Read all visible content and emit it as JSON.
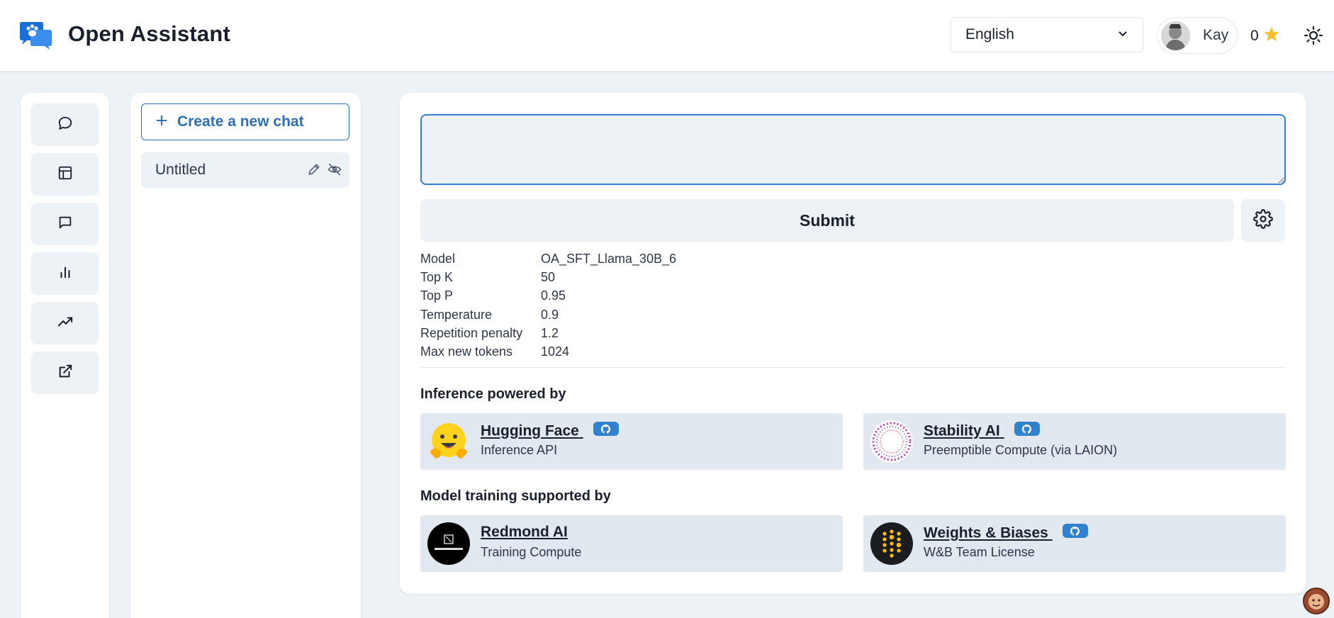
{
  "header": {
    "app_title": "Open Assistant",
    "language": "English",
    "user_name": "Kay",
    "score": "0"
  },
  "nav": {
    "items": [
      {
        "icon": "chat-bubble-icon"
      },
      {
        "icon": "dashboard-layout-icon"
      },
      {
        "icon": "message-square-icon"
      },
      {
        "icon": "bar-chart-icon"
      },
      {
        "icon": "trending-up-icon"
      },
      {
        "icon": "external-link-icon"
      }
    ]
  },
  "chat_list": {
    "new_chat_label": "Create a new chat",
    "items": [
      {
        "title": "Untitled"
      }
    ]
  },
  "main": {
    "prompt_value": "",
    "submit_label": "Submit",
    "params": [
      {
        "label": "Model",
        "value": "OA_SFT_Llama_30B_6"
      },
      {
        "label": "Top K",
        "value": "50"
      },
      {
        "label": "Top P",
        "value": "0.95"
      },
      {
        "label": "Temperature",
        "value": "0.9"
      },
      {
        "label": "Repetition penalty",
        "value": "1.2"
      },
      {
        "label": "Max new tokens",
        "value": "1024"
      }
    ],
    "inference_title": "Inference powered by",
    "training_title": "Model training supported by",
    "sponsors": [
      {
        "name": "Hugging Face",
        "desc": "Inference API"
      },
      {
        "name": "Stability AI",
        "desc": "Preemptible Compute (via LAION)"
      },
      {
        "name": "Redmond AI",
        "desc": "Training Compute"
      },
      {
        "name": "Weights & Biases",
        "desc": "W&B Team License"
      }
    ]
  },
  "colors": {
    "accent": "#3182ce",
    "button_blue": "#2c6fb3",
    "panel_bg": "#edf2f7"
  }
}
